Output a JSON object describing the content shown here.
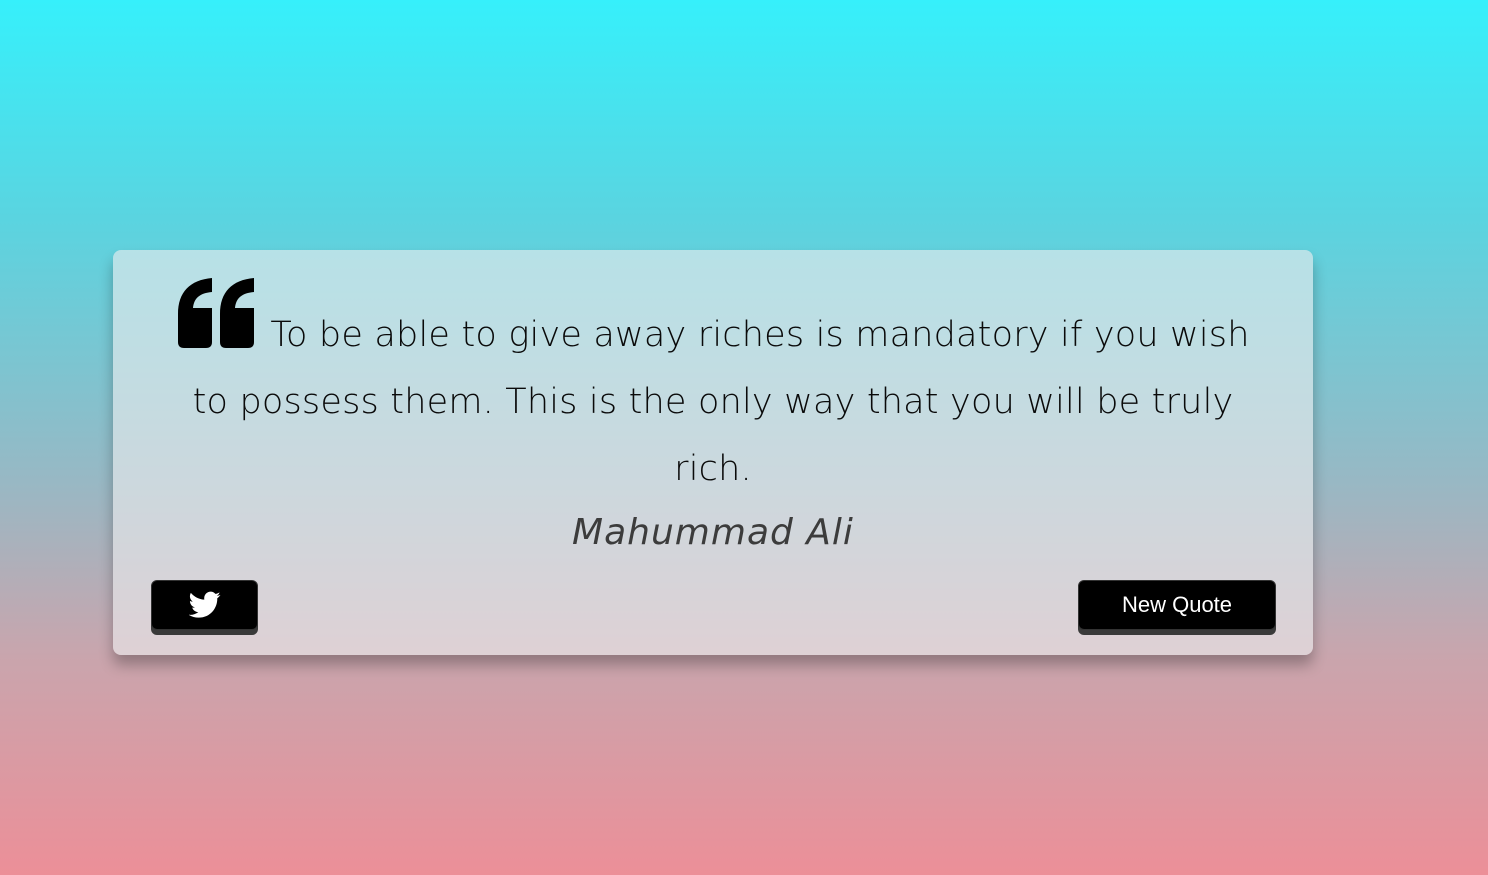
{
  "quote": {
    "text": "To be able to give away riches is mandatory if you wish to possess them. This is the only way that you will be truly rich.",
    "author": "Mahummad Ali",
    "quote_icon": "left-double-quote-icon"
  },
  "actions": {
    "tweet_icon": "twitter-icon",
    "new_quote_label": "New Quote"
  },
  "colors": {
    "background_top": "#36f0fb",
    "background_bottom": "#ec8f98",
    "button_bg": "#000000",
    "button_text": "#ffffff"
  }
}
